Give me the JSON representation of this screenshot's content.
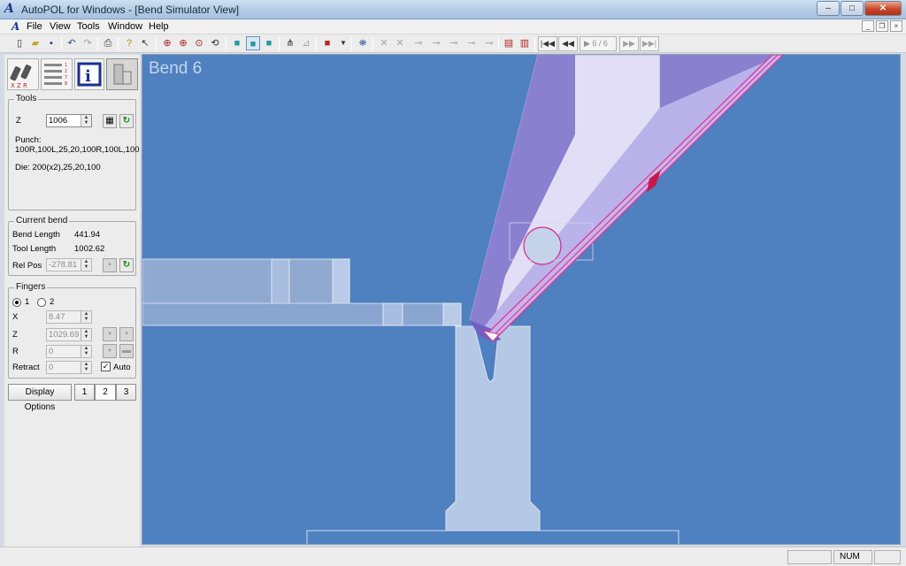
{
  "window": {
    "title": "AutoPOL for Windows - [Bend Simulator View]",
    "minimize": "–",
    "maximize": "□",
    "close": "✕"
  },
  "menu": {
    "items": [
      "File",
      "View",
      "Tools",
      "Window",
      "Help"
    ],
    "mdi": [
      "_",
      "❐",
      "×"
    ]
  },
  "toolbar": {
    "nav_first": "|◀◀",
    "nav_prev": "◀◀",
    "nav_position": "▶  6 / 6",
    "nav_next": "▶▶",
    "nav_last": "▶▶|"
  },
  "left": {
    "mode_icons": [
      "tools-xzr-icon",
      "bend-table-icon",
      "info-icon",
      "finger-setup-icon"
    ],
    "tools": {
      "label": "Tools",
      "z_label": "Z",
      "z_value": "1006",
      "punch_label": "Punch:",
      "punch_value": "100R,100L,25,20,100R,100L,100",
      "die_text": "Die: 200(x2),25,20,100"
    },
    "current_bend": {
      "label": "Current bend",
      "bend_length_label": "Bend Length",
      "bend_length_value": "441.94",
      "tool_length_label": "Tool Length",
      "tool_length_value": "1002.62",
      "rel_pos_label": "Rel Pos",
      "rel_pos_value": "-278.81"
    },
    "fingers": {
      "label": "Fingers",
      "radio_1": "1",
      "radio_2": "2",
      "selected": 1,
      "x_label": "X",
      "x_value": "8.47",
      "z_label": "Z",
      "z_value": "1029.69",
      "r_label": "R",
      "r_value": "0",
      "retract_label": "Retract",
      "retract_value": "0",
      "auto_label": "Auto",
      "auto_checked": true
    },
    "display_options": "Display Options",
    "view_tabs": [
      "1",
      "2",
      "3"
    ],
    "view_tab_selected": "2"
  },
  "viewport": {
    "title": "Bend 6",
    "background_color": "#4f80c0",
    "punch_color": "#8a80d0",
    "sheet_edge_color": "#e0379c"
  },
  "status": {
    "num": "NUM"
  }
}
